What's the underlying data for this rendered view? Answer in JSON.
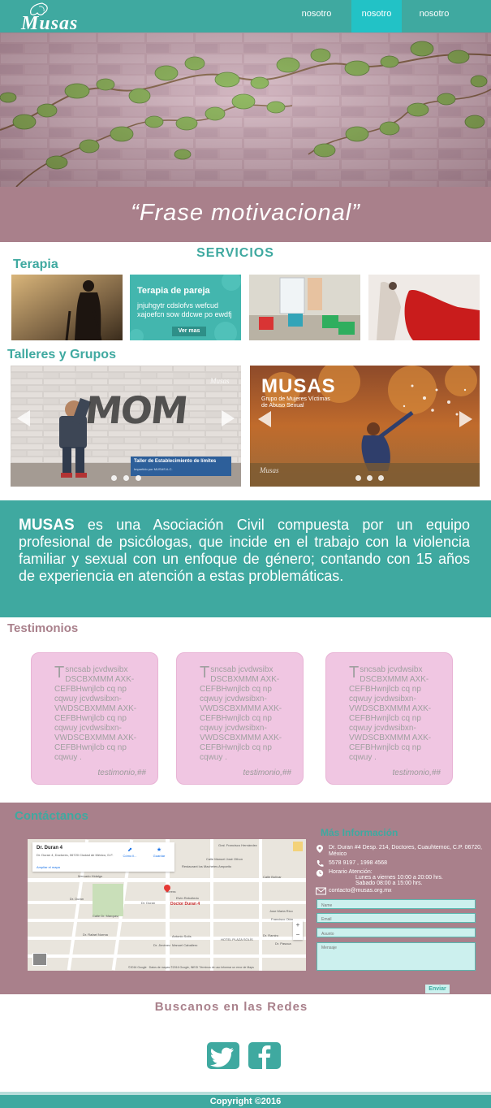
{
  "brand": {
    "logo_text": "Musas"
  },
  "nav": {
    "items": [
      "nosotro",
      "nosotro",
      "nosotro"
    ],
    "active_index": 1,
    "active_color": "#22c2c6"
  },
  "colors": {
    "teal": "#3fa9a0",
    "mauve": "#a9808b",
    "pink_card": "#f0c6e2"
  },
  "hero": {
    "quote": "“Frase motivacional”"
  },
  "services": {
    "title": "SERVICIOS",
    "terapia_label": "Terapia",
    "pareja": {
      "title": "Terapia de pareja",
      "text": "jnjuhgytr cdslofvs wefcud xajoefcn sow ddcwe po ewdfj",
      "button": "Ver mas"
    }
  },
  "talleres": {
    "label": "Talleres y Grupos",
    "slide1": {
      "graffiti": "MOM",
      "box_title": "Taller de Establecimiento de límites",
      "box_sub": "Impartido por MUSAS A.C.",
      "dots": 3,
      "active_dot": 0
    },
    "slide2": {
      "title": "MUSAS",
      "subtitle": "Grupo de Mujeres Víctimas de Abuso Sexual",
      "dots": 3,
      "active_dot": 1
    }
  },
  "about": {
    "brand": "MUSAS",
    "text": " es una Asociación Civil compuesta por un equipo profesional de psicólogas, que incide en el trabajo con la violencia familiar y sexual con un enfoque de género; contando con 15 años de experiencia en atención a estas problemáticas."
  },
  "testimonios": {
    "title": "Testimonios",
    "cards": [
      {
        "initial": "T",
        "text": "sncsab jcvdwsibx DSCBXMMM AXK-CEFBHwnjlcb cq np cqwuy jcvdwsibxn-VWDSCBXMMM AXK-CEFBHwnjlcb cq np cqwuy jcvdwsibxn-VWDSCBXMMM AXK-CEFBHwnjlcb cq np cqwuy .",
        "signature": "testimonio,##"
      },
      {
        "initial": "T",
        "text": "sncsab jcvdwsibx DSCBXMMM AXK-CEFBHwnjlcb cq np cqwuy jcvdwsibxn-VWDSCBXMMM AXK-CEFBHwnjlcb cq np cqwuy jcvdwsibxn-VWDSCBXMMM AXK-CEFBHwnjlcb cq np cqwuy .",
        "signature": "testimonio,##"
      },
      {
        "initial": "T",
        "text": "sncsab jcvdwsibx DSCBXMMM AXK-CEFBHwnjlcb cq np cqwuy jcvdwsibxn-VWDSCBXMMM AXK-CEFBHwnjlcb cq np cqwuy jcvdwsibxn-VWDSCBXMMM AXK-CEFBHwnjlcb cq np cqwuy .",
        "signature": "testimonio,##"
      }
    ]
  },
  "contact": {
    "title": "Contáctanos",
    "map": {
      "place_name": "Dr. Duran 4",
      "place_address": "Dr. Duran 4, Doctores, 06720 Ciudad de México, D.F.",
      "link": "Ampliar el mapa",
      "btn_directions": "Cómo ll...",
      "btn_save": "Guardar",
      "marker_label": "Doctor Duran 4",
      "streets": [
        "Calle Manuel José Othon",
        "Gral. Francisco Hernández",
        "Dr. Duran",
        "Calle Dr. Marquez",
        "Dr. Rafael Norma",
        "Dr. Pascua",
        "Manuel Caballero",
        "Antonio Solís",
        "Jose Maria Rico",
        "Dr. Ramiro",
        "Dr. Jiménez",
        "Mercado Hidalgo",
        "Elvin Rebolledo",
        "Francisco Otón",
        "HOTEL PLAZA SOLÍS",
        "Restaurant los Machetes Amparito",
        "Obrera",
        "Calle Bolívar"
      ],
      "footer": "©2016 Google · Datos de mapas ©2016 Google, INEGI    Términos de uso    Informar un error de Maps",
      "zoom_in": "+",
      "zoom_out": "−"
    },
    "info": {
      "title": "Más Información",
      "address": "Dr. Duran #4 Desp. 214, Doctores, Cuauhtemoc, C.P. 06720, México",
      "phone": "5578 9197 , 1998 4568",
      "hours_label": "Horario Atención:",
      "hours_1": "Lunes a viernes 10:00 a 20:00 hrs.",
      "hours_2": "Sabado 08:00 a 15:00 hrs.",
      "email": "contacto@musas.org.mx"
    },
    "form": {
      "name": "Name",
      "email": "Email",
      "subject": "Asunto",
      "message": "Mensaje",
      "send": "Enviar"
    }
  },
  "social": {
    "title": "Buscanos en las Redes",
    "icons": [
      "twitter-icon",
      "facebook-icon"
    ]
  },
  "footer": {
    "copyright": "Copyright ©2016"
  }
}
